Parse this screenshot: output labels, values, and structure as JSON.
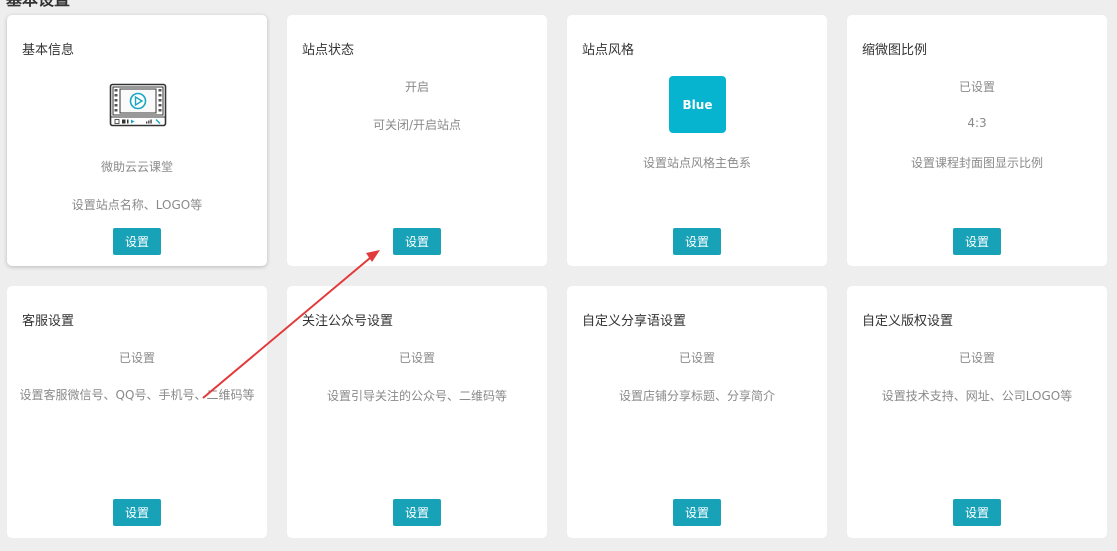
{
  "section": {
    "title": "基本设置"
  },
  "colors": {
    "accent": "#17a2b8",
    "swatch": "#06b4d0",
    "arrow": "#e23a3a"
  },
  "cards": [
    {
      "title": "基本信息",
      "icon": "video-player-icon",
      "lines": [
        "微助云云课堂",
        "设置站点名称、LOGO等"
      ],
      "button": "设置"
    },
    {
      "title": "站点状态",
      "lines": [
        "开启",
        "可关闭/开启站点"
      ],
      "button": "设置"
    },
    {
      "title": "站点风格",
      "swatch_label": "Blue",
      "lines": [
        "设置站点风格主色系"
      ],
      "button": "设置"
    },
    {
      "title": "缩微图比例",
      "lines": [
        "已设置",
        "4:3",
        "设置课程封面图显示比例"
      ],
      "button": "设置"
    },
    {
      "title": "客服设置",
      "lines": [
        "已设置",
        "设置客服微信号、QQ号、手机号、二维码等"
      ],
      "button": "设置"
    },
    {
      "title": "关注公众号设置",
      "lines": [
        "已设置",
        "设置引导关注的公众号、二维码等"
      ],
      "button": "设置"
    },
    {
      "title": "自定义分享语设置",
      "lines": [
        "已设置",
        "设置店铺分享标题、分享简介"
      ],
      "button": "设置"
    },
    {
      "title": "自定义版权设置",
      "lines": [
        "已设置",
        "设置技术支持、网址、公司LOGO等"
      ],
      "button": "设置"
    }
  ]
}
